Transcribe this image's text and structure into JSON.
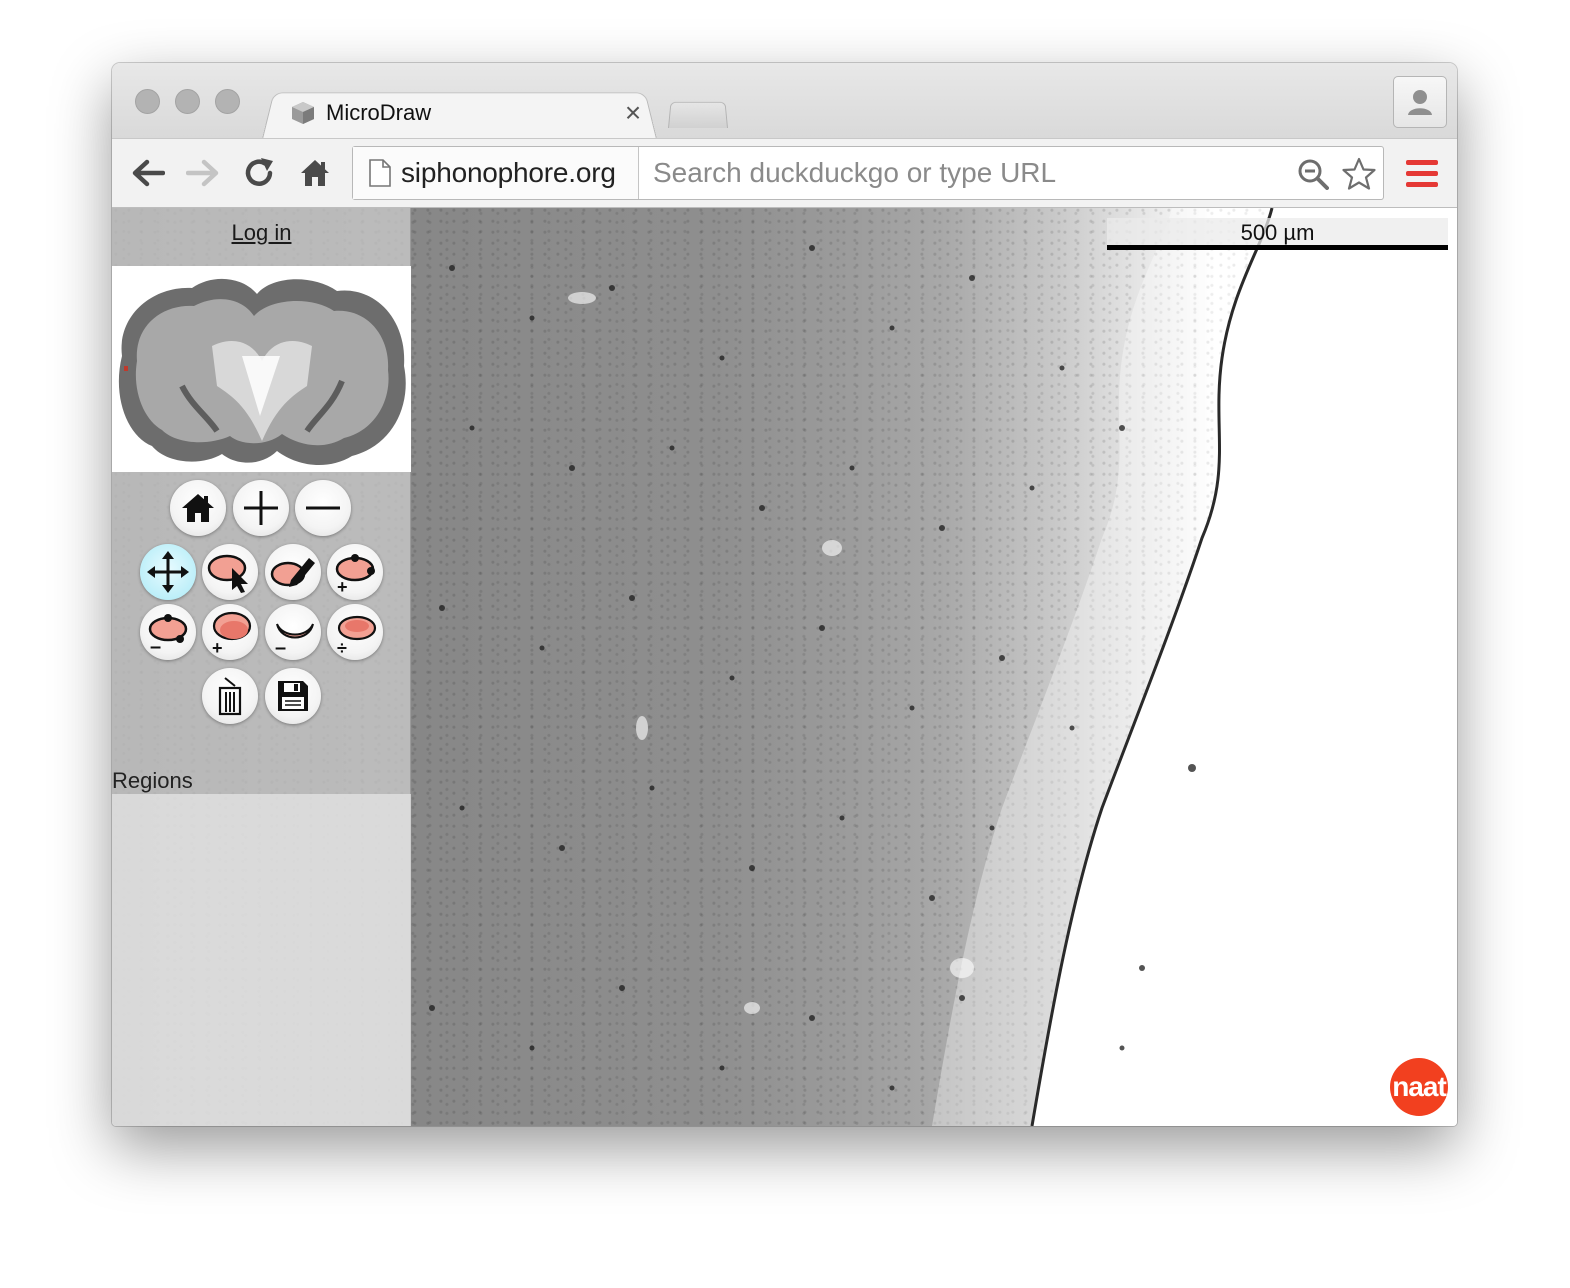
{
  "browser": {
    "tab_title": "MicroDraw",
    "tab_close": "×",
    "site_chip": "siphonophore.org",
    "search_placeholder": "Search duckduckgo or type URL",
    "icons": {
      "back": "back-arrow-icon",
      "forward": "forward-arrow-icon",
      "reload": "reload-icon",
      "home": "home-icon",
      "page": "page-icon",
      "search": "search-icon",
      "bookmark": "star-icon",
      "menu": "hamburger-menu-icon",
      "profile": "person-icon"
    },
    "menu_color": "#e53935"
  },
  "app": {
    "login_label": "Log in",
    "regions_label": "Regions",
    "scalebar_label": "500 µm",
    "badge_label": "naat",
    "badge_color": "#f2401f",
    "active_tool_color": "#bdeff9",
    "tools": [
      {
        "name": "home-view",
        "icon": "home-icon"
      },
      {
        "name": "zoom-in",
        "icon": "plus-icon"
      },
      {
        "name": "zoom-out",
        "icon": "minus-icon"
      },
      {
        "name": "navigate",
        "icon": "move-arrows-icon",
        "active": true
      },
      {
        "name": "select",
        "icon": "region-select-icon"
      },
      {
        "name": "draw",
        "icon": "region-draw-icon"
      },
      {
        "name": "add-point",
        "icon": "add-point-icon"
      },
      {
        "name": "delete-point",
        "icon": "delete-point-icon"
      },
      {
        "name": "add-region",
        "icon": "add-region-icon"
      },
      {
        "name": "subtract-region",
        "icon": "subtract-region-icon"
      },
      {
        "name": "split-region",
        "icon": "split-region-icon"
      },
      {
        "name": "delete",
        "icon": "trash-icon"
      },
      {
        "name": "save",
        "icon": "save-icon"
      }
    ]
  }
}
